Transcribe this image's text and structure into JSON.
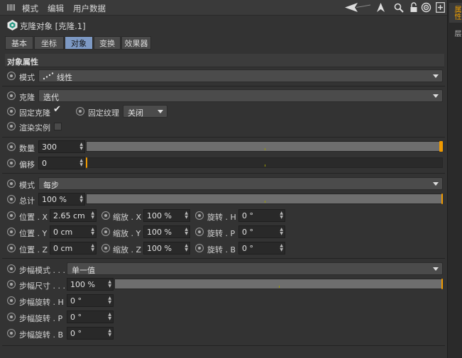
{
  "menu": {
    "items": [
      "模式",
      "编辑",
      "用户数据"
    ]
  },
  "right_tabs": [
    "属性",
    "层"
  ],
  "object": {
    "title": "克隆对象 [克隆.1]"
  },
  "tabs": [
    "基本",
    "坐标",
    "对象",
    "变换",
    "效果器"
  ],
  "active_tab": "对象",
  "section": {
    "title": "对象属性"
  },
  "mode_row": {
    "label": "模式",
    "value": "线性"
  },
  "clone_row": {
    "label": "克隆",
    "value": "迭代"
  },
  "fix_clone": {
    "label": "固定克隆",
    "checked": true
  },
  "fix_texture": {
    "label": "固定纹理",
    "value": "关闭"
  },
  "render_instance": {
    "label": "渲染实例",
    "checked": false
  },
  "count": {
    "label": "数量",
    "value": "300",
    "slider_fraction": 1.0
  },
  "offset": {
    "label": "偏移",
    "value": "0",
    "slider_fraction": 0.0
  },
  "mode2": {
    "label": "模式",
    "value": "每步"
  },
  "total": {
    "label": "总计",
    "value": "100 %",
    "slider_fraction": 1.0
  },
  "position": [
    {
      "label": "位置 . X",
      "value": "2.65 cm"
    },
    {
      "label": "位置 . Y",
      "value": "0 cm"
    },
    {
      "label": "位置 . Z",
      "value": "0 cm"
    }
  ],
  "scale": [
    {
      "label": "缩放 . X",
      "value": "100 %"
    },
    {
      "label": "缩放 . Y",
      "value": "100 %"
    },
    {
      "label": "缩放 . Z",
      "value": "100 %"
    }
  ],
  "rotation": [
    {
      "label": "旋转 . H",
      "value": "0 °"
    },
    {
      "label": "旋转 . P",
      "value": "0 °"
    },
    {
      "label": "旋转 . B",
      "value": "0 °"
    }
  ],
  "step_mode": {
    "label": "步幅模式 . . .",
    "value": "单一值"
  },
  "step_size": {
    "label": "步幅尺寸 . . .",
    "value": "100 %",
    "slider_fraction": 1.0
  },
  "step_rot": [
    {
      "label": "步幅旋转 . H",
      "value": "0 °"
    },
    {
      "label": "步幅旋转 . P",
      "value": "0 °"
    },
    {
      "label": "步幅旋转 . B",
      "value": "0 °"
    }
  ],
  "colors": {
    "accent": "#f09a00",
    "active_tab": "#7d99c4",
    "panel": "#333333"
  }
}
